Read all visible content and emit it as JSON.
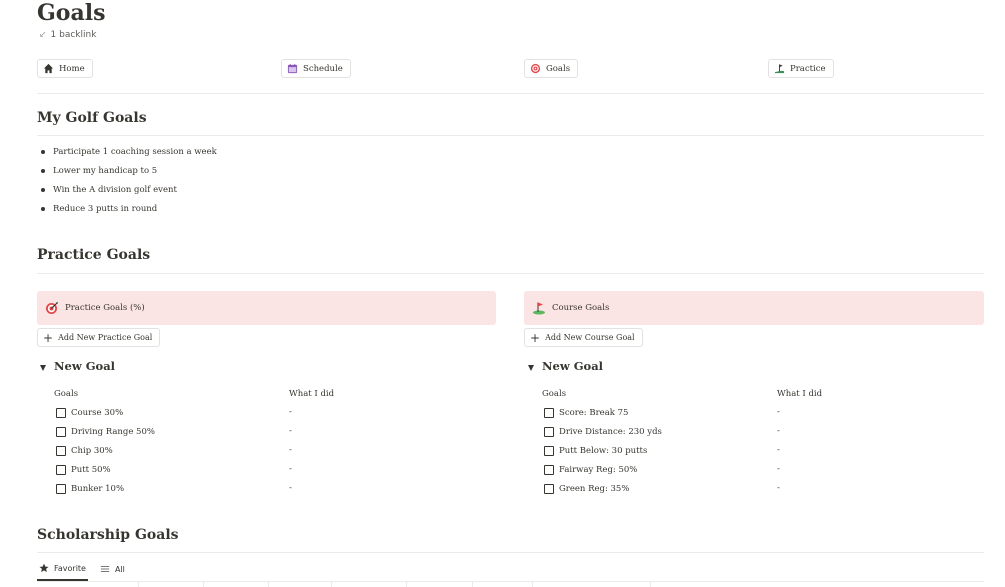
{
  "page": {
    "title": "Goals",
    "backlink": "1 backlink"
  },
  "nav": [
    {
      "label": "Home",
      "icon": "home-icon"
    },
    {
      "label": "Schedule",
      "icon": "calendar-icon"
    },
    {
      "label": "Goals",
      "icon": "target-icon"
    },
    {
      "label": "Practice",
      "icon": "golfer-icon"
    }
  ],
  "golf_goals": {
    "heading": "My Golf Goals",
    "items": [
      "Participate 1 coaching session a week",
      "Lower my handicap to 5",
      "Win the A division golf event",
      "Reduce 3 putts in round"
    ]
  },
  "practice_goals": {
    "heading": "Practice Goals",
    "left": {
      "callout": "Practice Goals (%)",
      "add_label": "Add New Practice Goal",
      "toggle": "New Goal",
      "col_goals": "Goals",
      "col_did": "What I did",
      "rows": [
        {
          "goal": "Course 30%",
          "did": "-"
        },
        {
          "goal": "Driving Range 50%",
          "did": "-"
        },
        {
          "goal": "Chip 30%",
          "did": "-"
        },
        {
          "goal": "Putt 50%",
          "did": "-"
        },
        {
          "goal": "Bunker 10%",
          "did": "-"
        }
      ]
    },
    "right": {
      "callout": "Course Goals",
      "add_label": "Add New Course Goal",
      "toggle": "New Goal",
      "col_goals": "Goals",
      "col_did": "What I did",
      "rows": [
        {
          "goal": "Score: Break 75",
          "did": "-"
        },
        {
          "goal": "Drive Distance: 230 yds",
          "did": "-"
        },
        {
          "goal": "Putt Below: 30 putts",
          "did": "-"
        },
        {
          "goal": "Fairway Reg: 50%",
          "did": "-"
        },
        {
          "goal": "Green Reg: 35%",
          "did": "-"
        }
      ]
    }
  },
  "scholarship": {
    "heading": "Scholarship Goals",
    "tabs": [
      {
        "label": "Favorite",
        "icon": "star-icon",
        "active": true
      },
      {
        "label": "All",
        "icon": "list-icon",
        "active": false
      }
    ]
  },
  "colors": {
    "callout_bg": "#fbe4e4",
    "text": "#37352f",
    "divider": "#ebeae7"
  }
}
